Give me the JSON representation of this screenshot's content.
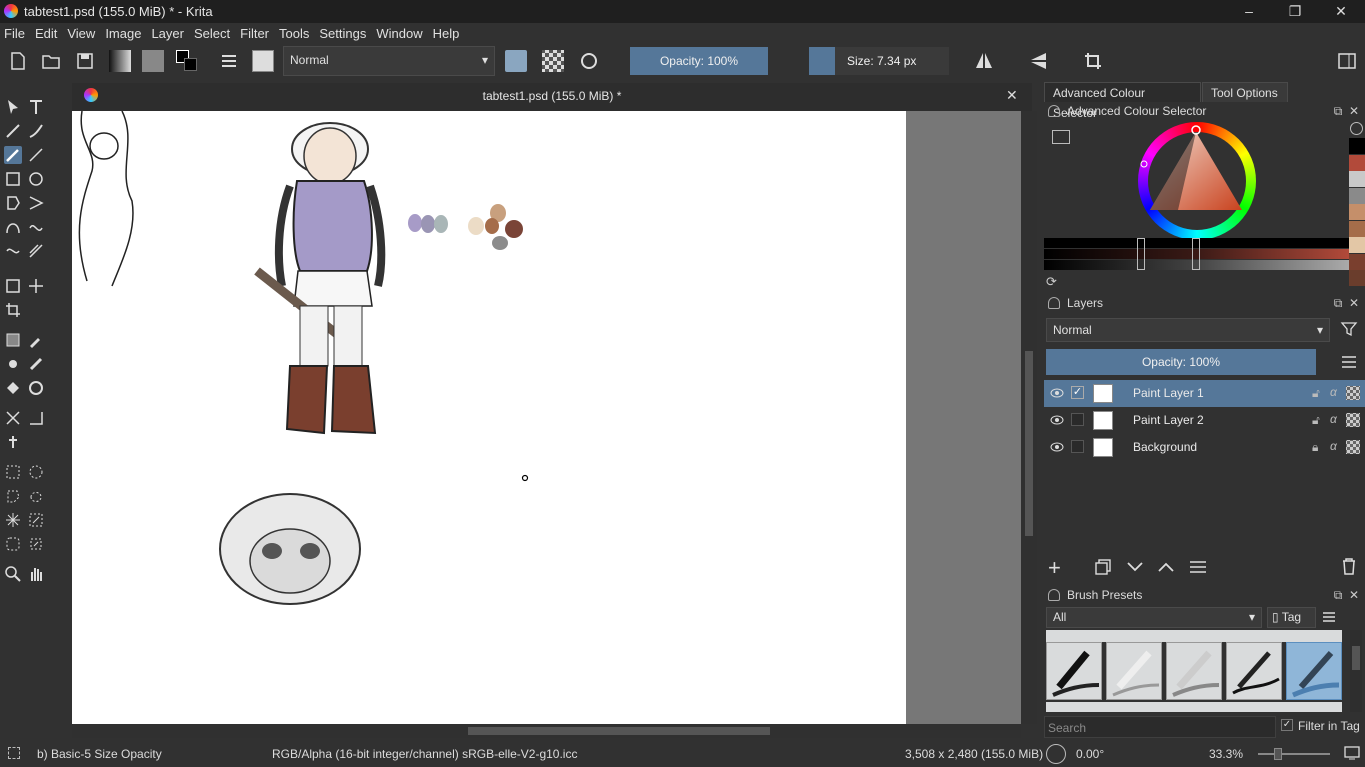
{
  "window": {
    "title": "tabtest1.psd (155.0 MiB) * - Krita",
    "minimize": "–",
    "maximize": "❐",
    "close": "✕"
  },
  "menu": [
    "File",
    "Edit",
    "View",
    "Image",
    "Layer",
    "Select",
    "Filter",
    "Tools",
    "Settings",
    "Window",
    "Help"
  ],
  "toolbar": {
    "blend_mode": "Normal",
    "opacity_label": "Opacity: 100%",
    "size_label": "Size: 7.34 px"
  },
  "document": {
    "tab_title": "tabtest1.psd (155.0 MiB) *",
    "close": "✕"
  },
  "colour_selector": {
    "tab_label": "Advanced Colour Selector",
    "tool_options_tab": "Tool Options",
    "title": "Advanced Colour Selector",
    "history_swatches": [
      "#000000",
      "#b24a3a",
      "#c9c9c9",
      "#8a8a8a",
      "#c58f6a",
      "#a56d4a",
      "#e3c7a6",
      "#7a3f2e",
      "#6a3d2c"
    ]
  },
  "layers": {
    "title": "Layers",
    "blend_mode": "Normal",
    "opacity_label": "Opacity:  100%",
    "items": [
      {
        "name": "Paint Layer 1",
        "selected": true,
        "checked": true
      },
      {
        "name": "Paint Layer 2",
        "selected": false,
        "checked": false
      },
      {
        "name": "Background",
        "selected": false,
        "checked": false
      }
    ]
  },
  "brush_presets": {
    "title": "Brush Presets",
    "filter": "All",
    "tag_label": "Tag",
    "search_placeholder": "Search",
    "filter_in_tag": "Filter in Tag"
  },
  "status": {
    "brush": "b) Basic-5 Size Opacity",
    "colorspace": "RGB/Alpha (16-bit integer/channel)  sRGB-elle-V2-g10.icc",
    "dimensions": "3,508 x 2,480 (155.0 MiB)",
    "rotation": "0.00°",
    "zoom": "33.3%"
  },
  "colors": {
    "accent": "#557799",
    "panel": "#313131",
    "canvas_bg": "#777777"
  }
}
